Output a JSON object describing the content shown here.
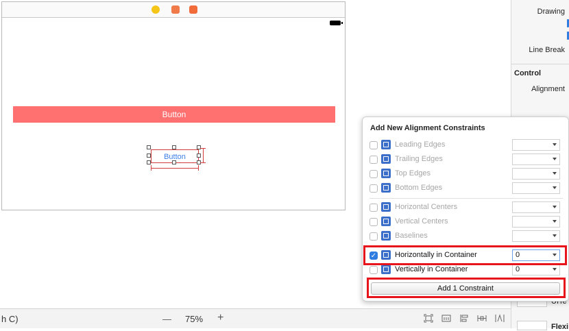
{
  "canvas": {
    "big_button_label": "Button",
    "small_button_label": "Button"
  },
  "inspector": {
    "drawing_label": "Drawing",
    "line_break_label": "Line Break",
    "control_header": "Control",
    "alignment_label": "Alignment",
    "ul_text": "UITe",
    "flex_text": "Flexi"
  },
  "bottom_bar": {
    "left_fragment": "h C)",
    "zoom_out": "—",
    "zoom_level": "75%",
    "zoom_in": "+"
  },
  "popover": {
    "title": "Add New Alignment Constraints",
    "rows": [
      {
        "label": "Leading Edges",
        "checked": false,
        "value": ""
      },
      {
        "label": "Trailing Edges",
        "checked": false,
        "value": ""
      },
      {
        "label": "Top Edges",
        "checked": false,
        "value": ""
      },
      {
        "label": "Bottom Edges",
        "checked": false,
        "value": ""
      },
      {
        "label": "Horizontal Centers",
        "checked": false,
        "value": ""
      },
      {
        "label": "Vertical Centers",
        "checked": false,
        "value": ""
      },
      {
        "label": "Baselines",
        "checked": false,
        "value": ""
      },
      {
        "label": "Horizontally in Container",
        "checked": true,
        "value": "0"
      },
      {
        "label": "Vertically in Container",
        "checked": false,
        "value": "0"
      }
    ],
    "add_button_label": "Add 1 Constraint",
    "checkmark": "✓"
  },
  "colors": {
    "accent": "#2f7de1",
    "button_fill": "#ff7070",
    "highlight": "#e8141c"
  }
}
